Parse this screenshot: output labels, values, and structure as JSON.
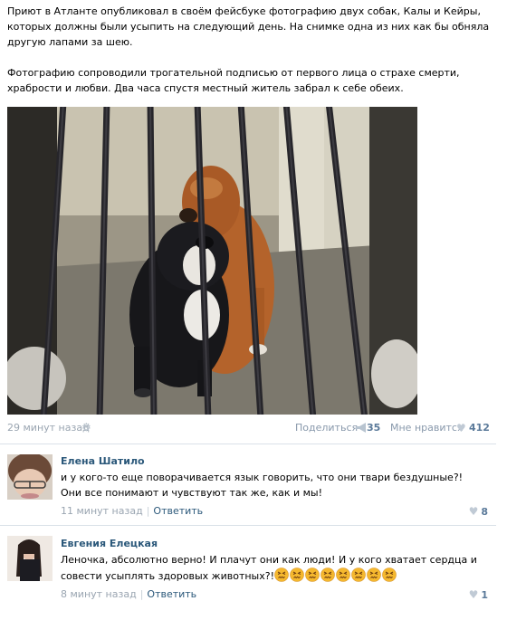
{
  "post": {
    "paragraph1": "Приют в Атланте опубликовал в своём фейсбуке фотографию двух собак, Калы и Кейры, которых должны были усыпить на следующий день. На снимке одна из них как бы обняла другую лапами за шею.",
    "paragraph2": "Фотографию сопроводили трогательной подписью от первого лица о страхе смерти, храбрости и любви. Два часа спустя местный житель забрал к себе обеих.",
    "time": "29 минут назад",
    "share_label": "Поделиться",
    "share_count": "35",
    "like_label": "Мне нравится",
    "like_count": "412",
    "icons": {
      "settings": "gear-icon",
      "share": "megaphone-icon",
      "like": "heart-icon"
    }
  },
  "comments": [
    {
      "author": "Елена Шатило",
      "text": "и у кого-то еще поворачивается язык говорить, что они твари бездушные?! Они все понимают и чувствуют так же, как и мы!",
      "time": "11 минут назад",
      "reply_label": "Ответить",
      "likes": "8"
    },
    {
      "author": "Евгения Елецкая",
      "text": "Леночка, абсолютно верно! И плачут они как люди! И у кого хватает сердца и совести усыплять здоровых животных?!",
      "emoji": "confounded-face",
      "emoji_count": 8,
      "time": "8 минут назад",
      "reply_label": "Ответить",
      "likes": "1"
    }
  ],
  "colors": {
    "link": "#2b587a",
    "muted": "#9aa5b1",
    "divider": "#dae1e8",
    "emoji": "#f5b82e"
  }
}
